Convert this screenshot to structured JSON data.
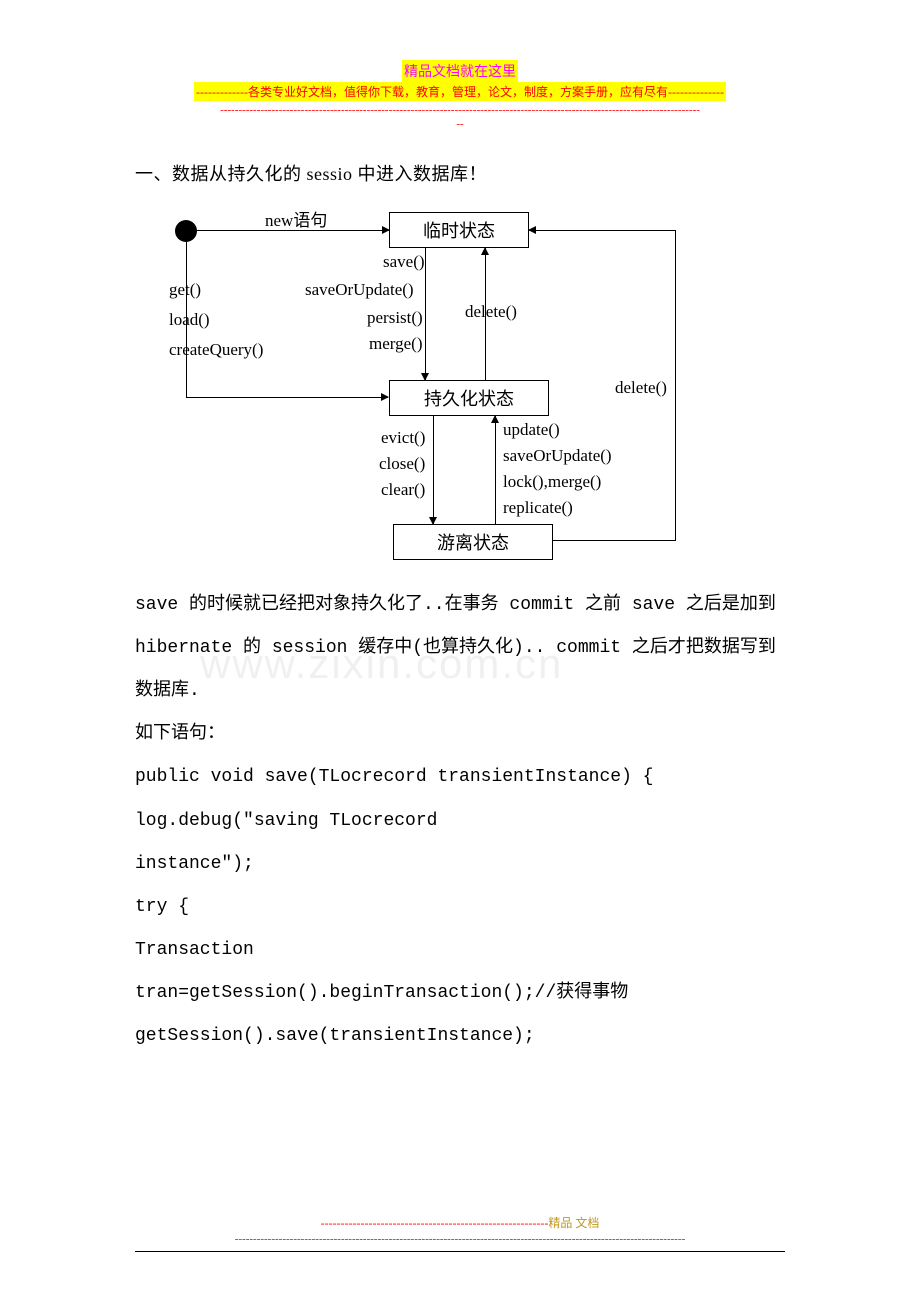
{
  "header": {
    "line1": "精品文档就在这里",
    "line2": "-------------各类专业好文档，值得你下载，教育，管理，论文，制度，方案手册，应有尽有--------------",
    "line3a": "-----------------------------------------------------------------------------------------------------------------------------------",
    "line3b": "--"
  },
  "title": "一、数据从持久化的 sessio 中进入数据库！",
  "diagram": {
    "newStmt": "new语句",
    "boxTransient": "临时状态",
    "boxPersistent": "持久化状态",
    "boxDetached": "游离状态",
    "leftMethods": {
      "get": "get()",
      "load": "load()",
      "createQuery": "createQuery()"
    },
    "toPersistent": {
      "save": "save()",
      "saveOrUpdate": "saveOrUpdate()",
      "persist": "persist()",
      "merge": "merge()"
    },
    "delete": "delete()",
    "evictGroup": {
      "evict": "evict()",
      "close": "close()",
      "clear": "clear()"
    },
    "updateGroup": {
      "update": "update()",
      "saveOrUpdate": "saveOrUpdate()",
      "lockMerge": "lock(),merge()",
      "replicate": "replicate()"
    }
  },
  "body": {
    "p1": "save 的时候就已经把对象持久化了..在事务 commit 之前 save 之后是加到 hibernate 的 session 缓存中(也算持久化).. commit 之后才把数据写到数据库.",
    "p2": "如下语句：",
    "c1": "public void save(TLocrecord transientInstance) {",
    "c2": "log.debug(\"saving TLocrecord",
    "c3": "instance\");",
    "c4": "try {",
    "c5": "Transaction",
    "c6": "tran=getSession().beginTransaction();//获得事物",
    "c7": "getSession().save(transientInstance);"
  },
  "watermark": "www.zixin.com.cn",
  "footer": {
    "ln1a": "---------------------------------------------------------",
    "ln1b": "精品   文档",
    "ln2": "---------------------------------------------------------------------------------------------------------------------------"
  }
}
